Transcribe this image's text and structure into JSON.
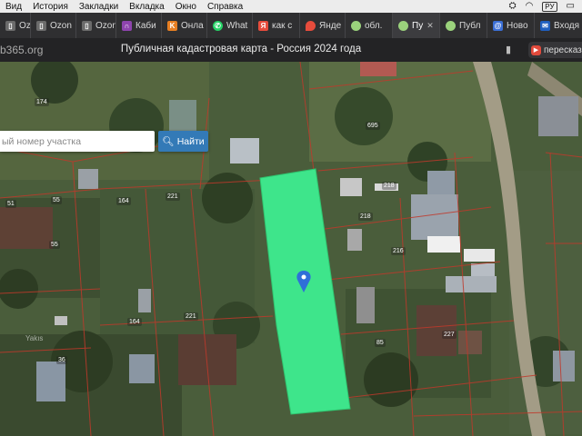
{
  "menubar": {
    "items": [
      "Вид",
      "История",
      "Закладки",
      "Вкладка",
      "Окно",
      "Справка"
    ],
    "input_source": "РУ"
  },
  "tabs": [
    {
      "label": "Ozon",
      "icon": "page-icon",
      "color": "#6b6b6b",
      "active": false
    },
    {
      "label": "Ozon",
      "icon": "page-icon",
      "color": "#6b6b6b",
      "active": false
    },
    {
      "label": "Ozon",
      "icon": "page-icon",
      "color": "#6b6b6b",
      "active": false
    },
    {
      "label": "Каби",
      "icon": "app-icon",
      "color": "#8e44ad",
      "active": false
    },
    {
      "label": "Онла",
      "icon": "k-icon",
      "color": "#e67e22",
      "active": false
    },
    {
      "label": "What",
      "icon": "whatsapp-icon",
      "color": "#25d366",
      "active": false
    },
    {
      "label": "как с",
      "icon": "yandex-icon",
      "color": "#e74c3c",
      "active": false
    },
    {
      "label": "Янде",
      "icon": "maps-icon",
      "color": "#e74c3c",
      "active": false
    },
    {
      "label": "обл.",
      "icon": "globe-icon",
      "color": "#9bd27c",
      "active": false
    },
    {
      "label": "Пу",
      "icon": "globe-icon",
      "color": "#9bd27c",
      "active": true
    },
    {
      "label": "Публ",
      "icon": "globe-icon",
      "color": "#9bd27c",
      "active": false
    },
    {
      "label": "Ново",
      "icon": "at-icon",
      "color": "#3b6fd6",
      "active": false
    },
    {
      "label": "Входя",
      "icon": "mail-icon",
      "color": "#1f5fbf",
      "active": false
    }
  ],
  "address": {
    "url": "b365.org",
    "title": "Публичная кадастровая карта - Россия 2024 года",
    "extension_label": "пересказ"
  },
  "map": {
    "search_placeholder": "ый номер участка",
    "find_label": "Найти",
    "selected_parcel_color": "#3ee58b",
    "marker_color": "#2f6fd8",
    "boundary_color": "#c0392b",
    "parcel_labels": [
      {
        "text": "174"
      },
      {
        "text": "695"
      },
      {
        "text": "164"
      },
      {
        "text": "221"
      },
      {
        "text": "218"
      },
      {
        "text": "218"
      },
      {
        "text": "216"
      },
      {
        "text": "51"
      },
      {
        "text": "55"
      },
      {
        "text": "55"
      },
      {
        "text": "164"
      },
      {
        "text": "221"
      },
      {
        "text": "85"
      },
      {
        "text": "227"
      },
      {
        "text": "36"
      },
      {
        "text": "Yakıs"
      }
    ]
  }
}
